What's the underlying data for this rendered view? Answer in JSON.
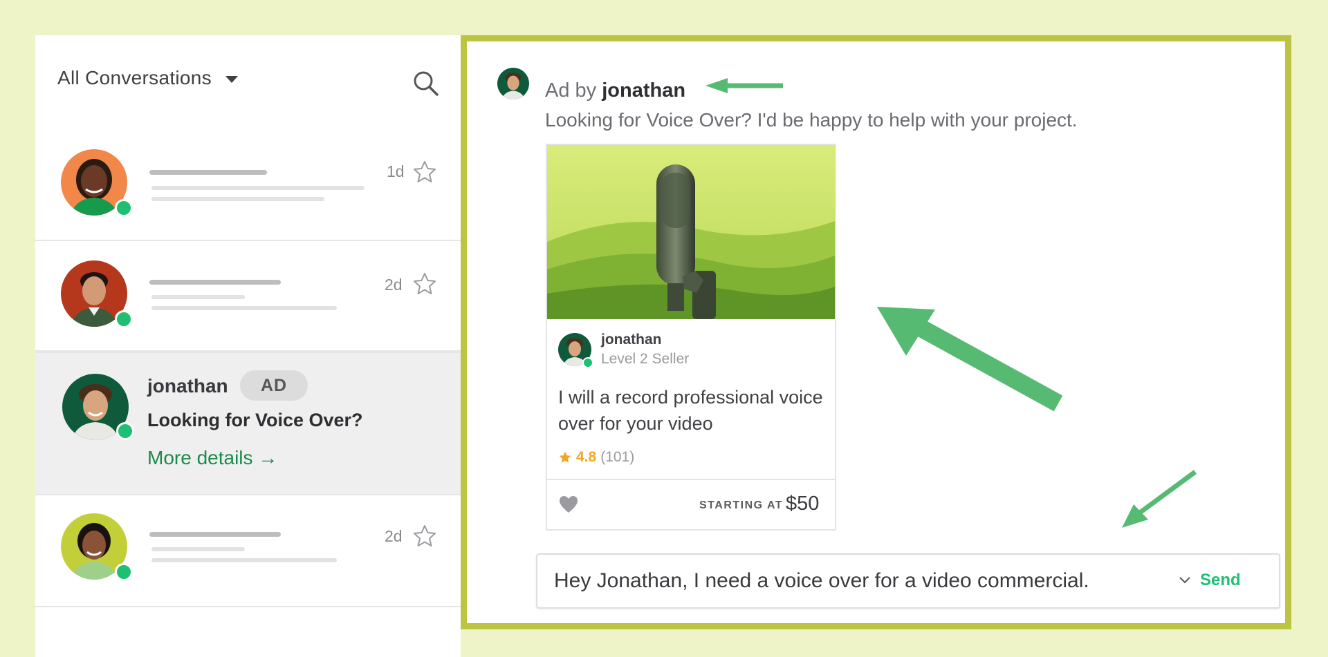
{
  "conversations_panel": {
    "filter_label": "All Conversations",
    "search_icon": "search-icon",
    "items": [
      {
        "time": "1d",
        "avatar_color": "#f2874a"
      },
      {
        "time": "2d",
        "avatar_color": "#b5381c"
      },
      {
        "name": "jonathan",
        "badge": "AD",
        "preview": "Looking for Voice Over?",
        "link": "More details →",
        "avatar_color": "#0f5a3a"
      },
      {
        "time": "2d",
        "avatar_color": "#c3cf39"
      }
    ]
  },
  "ad_message": {
    "prefix": "Ad by",
    "sender": "jonathan",
    "text": "Looking for Voice Over? I'd be happy to help with your project."
  },
  "gig_card": {
    "seller_name": "jonathan",
    "seller_level": "Level 2 Seller",
    "title": "I will a record professional voice over for your video",
    "rating": "4.8",
    "review_count": "(101)",
    "starting_label": "STARTING AT",
    "price": "$50"
  },
  "composer": {
    "value": "Hey Jonathan, I need a voice over for a video commercial.",
    "send_label": "Send"
  },
  "colors": {
    "background": "#eff3c8",
    "frame": "#bcc541",
    "accent_green": "#1dbf73",
    "annotation_arrow": "#56ba72",
    "link_green": "#1a8a4a",
    "rating_star": "#f4a622"
  }
}
